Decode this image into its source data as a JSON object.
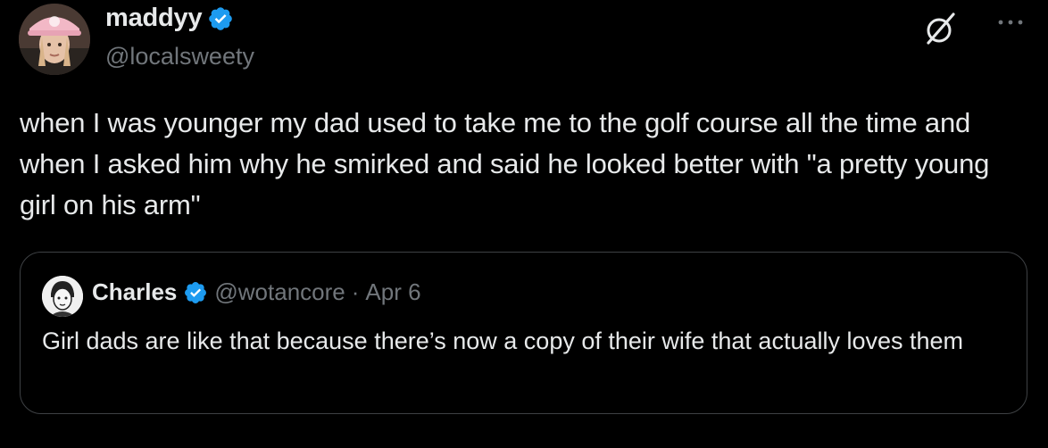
{
  "post": {
    "author": {
      "display_name": "maddyy",
      "handle": "@localsweety",
      "verified": true
    },
    "text": "when I was younger my dad used to take me to the golf course all the time and when I asked him why he smirked and said he looked better with \"a pretty young girl on his arm\"",
    "icons": [
      "grok-icon",
      "more-icon"
    ]
  },
  "quoted_post": {
    "author": {
      "display_name": "Charles",
      "handle": "@wotancore",
      "verified": true
    },
    "separator": "·",
    "date": "Apr 6",
    "text": "Girl dads are like that because there’s now a copy of their wife that actually loves them"
  },
  "colors": {
    "background": "#000000",
    "text_primary": "#e7e9ea",
    "text_secondary": "#71767b",
    "verified_blue": "#1d9bf0",
    "border": "#3e4144"
  }
}
